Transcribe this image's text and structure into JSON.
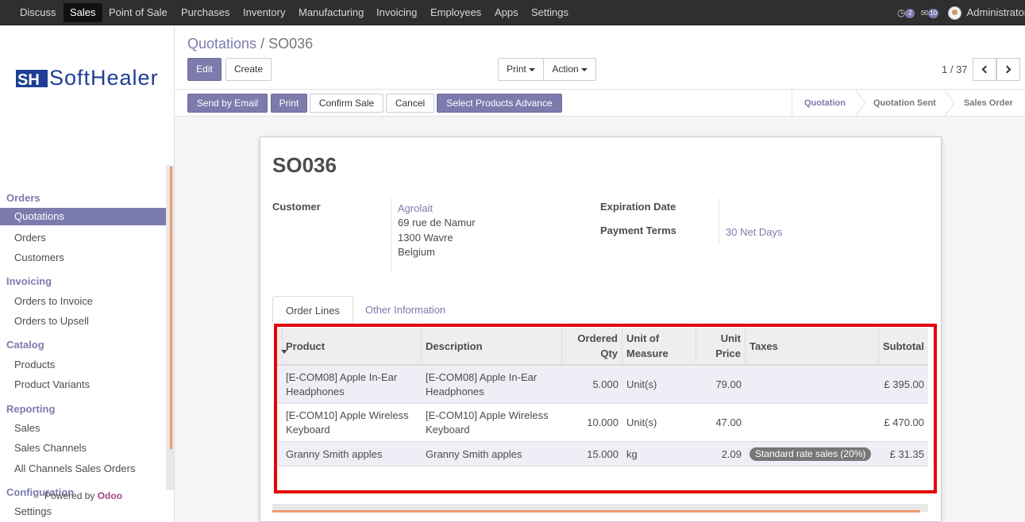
{
  "topnav": {
    "menus": [
      "Discuss",
      "Sales",
      "Point of Sale",
      "Purchases",
      "Inventory",
      "Manufacturing",
      "Invoicing",
      "Employees",
      "Apps",
      "Settings"
    ],
    "active_menu": "Sales",
    "activity_count": "2",
    "messages_count": "10",
    "user": "Administrator"
  },
  "sidebar": {
    "logo_text": "SoftHealer",
    "sections": [
      {
        "title": "Orders",
        "items": [
          "Quotations",
          "Orders",
          "Customers"
        ]
      },
      {
        "title": "Invoicing",
        "items": [
          "Orders to Invoice",
          "Orders to Upsell"
        ]
      },
      {
        "title": "Catalog",
        "items": [
          "Products",
          "Product Variants"
        ]
      },
      {
        "title": "Reporting",
        "items": [
          "Sales",
          "Sales Channels",
          "All Channels Sales Orders"
        ]
      },
      {
        "title": "Configuration",
        "items": [
          "Settings"
        ]
      }
    ],
    "active_item": "Quotations",
    "powered_by": "Powered by",
    "powered_brand": "Odoo"
  },
  "breadcrumb": {
    "parent": "Quotations",
    "separator": "/",
    "current": "SO036"
  },
  "buttons": {
    "edit": "Edit",
    "create": "Create",
    "print_menu": "Print",
    "action_menu": "Action",
    "send_email": "Send by Email",
    "print": "Print",
    "confirm": "Confirm Sale",
    "cancel": "Cancel",
    "select_products": "Select Products Advance"
  },
  "pager": {
    "value": "1 / 37"
  },
  "statusbar": {
    "steps": [
      "Quotation",
      "Quotation Sent",
      "Sales Order"
    ],
    "active": "Quotation"
  },
  "form": {
    "title": "SO036",
    "customer_label": "Customer",
    "customer_name": "Agrolait",
    "address": [
      "69 rue de Namur",
      "1300 Wavre",
      "Belgium"
    ],
    "expiration_label": "Expiration Date",
    "expiration_value": "",
    "payment_terms_label": "Payment Terms",
    "payment_terms_value": "30 Net Days"
  },
  "tabs": {
    "order_lines": "Order Lines",
    "other_info": "Other Information"
  },
  "table": {
    "headers": {
      "product": "Product",
      "description": "Description",
      "qty_1": "Ordered",
      "qty_2": "Qty",
      "uom_1": "Unit of",
      "uom_2": "Measure",
      "price_1": "Unit",
      "price_2": "Price",
      "taxes": "Taxes",
      "subtotal": "Subtotal"
    },
    "rows": [
      {
        "product_1": "[E-COM08] Apple In-Ear",
        "product_2": "Headphones",
        "desc_1": "[E-COM08] Apple In-Ear",
        "desc_2": "Headphones",
        "qty": "5.000",
        "uom": "Unit(s)",
        "price": "79.00",
        "tax": "",
        "subtotal": "£ 395.00"
      },
      {
        "product_1": "[E-COM10] Apple Wireless",
        "product_2": "Keyboard",
        "desc_1": "[E-COM10] Apple Wireless",
        "desc_2": "Keyboard",
        "qty": "10.000",
        "uom": "Unit(s)",
        "price": "47.00",
        "tax": "",
        "subtotal": "£ 470.00"
      },
      {
        "product_1": "Granny Smith apples",
        "product_2": "",
        "desc_1": "Granny Smith apples",
        "desc_2": "",
        "qty": "15.000",
        "uom": "kg",
        "price": "2.09",
        "tax": "Standard rate sales (20%)",
        "subtotal": "£ 31.35"
      }
    ]
  },
  "colors": {
    "brand": "#7c7bad",
    "highlight": "#e8000b",
    "navbar": "#2f2f2f",
    "accent": "#ef9a6d"
  }
}
